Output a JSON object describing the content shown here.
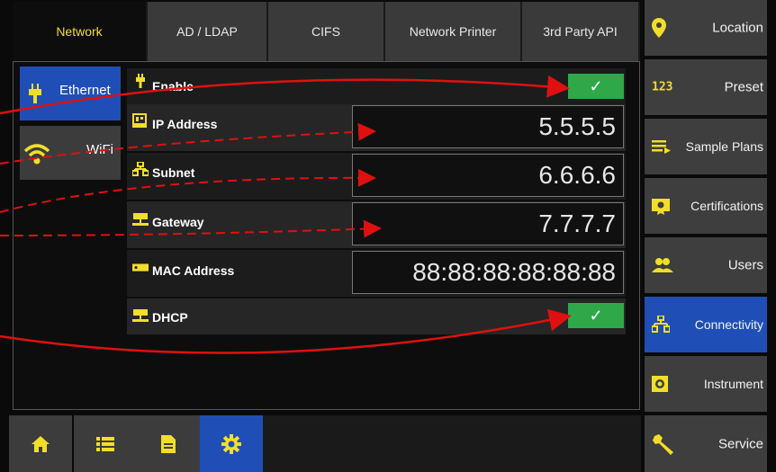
{
  "top_tabs": [
    {
      "label": "Network",
      "active": true
    },
    {
      "label": "AD / LDAP",
      "active": false
    },
    {
      "label": "CIFS",
      "active": false
    },
    {
      "label": "Network Printer",
      "active": false
    },
    {
      "label": "3rd Party API",
      "active": false
    }
  ],
  "left_nav": [
    {
      "label": "Ethernet",
      "icon": "ethernet-plug-icon",
      "active": true
    },
    {
      "label": "WiFi",
      "icon": "wifi-icon",
      "active": false
    }
  ],
  "settings": {
    "enable": {
      "label": "Enable",
      "icon": "plug-icon",
      "checked": true,
      "check_glyph": "✓"
    },
    "ip": {
      "label": "IP Address",
      "icon": "ip-icon",
      "value": "5.5.5.5"
    },
    "subnet": {
      "label": "Subnet",
      "icon": "subnet-icon",
      "value": "6.6.6.6"
    },
    "gateway": {
      "label": "Gateway",
      "icon": "gateway-icon",
      "value": "7.7.7.7"
    },
    "mac": {
      "label": "MAC Address",
      "icon": "mac-icon",
      "value": "88:88:88:88:88:88"
    },
    "dhcp": {
      "label": "DHCP",
      "icon": "dhcp-icon",
      "checked": true,
      "check_glyph": "✓"
    }
  },
  "right_nav": [
    {
      "label": "Location",
      "icon": "location-pin-icon",
      "active": false
    },
    {
      "label": "Preset",
      "icon": "preset-123-icon",
      "icon_text": "123",
      "active": false
    },
    {
      "label": "Sample Plans",
      "icon": "sample-plans-icon",
      "active": false
    },
    {
      "label": "Certifications",
      "icon": "certificate-icon",
      "active": false
    },
    {
      "label": "Users",
      "icon": "users-icon",
      "active": false
    },
    {
      "label": "Connectivity",
      "icon": "network-icon",
      "active": true
    },
    {
      "label": "Instrument",
      "icon": "instrument-gear-icon",
      "active": false
    },
    {
      "label": "Service",
      "icon": "wrench-icon",
      "active": false
    }
  ],
  "bottom_nav": [
    {
      "icon": "home-icon",
      "active": false
    },
    {
      "icon": "list-icon",
      "active": false
    },
    {
      "icon": "document-icon",
      "active": false
    },
    {
      "icon": "settings-gear-icon",
      "active": true
    }
  ],
  "colors": {
    "accent_yellow": "#f2de2a",
    "active_blue": "#1f4fb6",
    "check_green": "#2fa84a",
    "annotation_red": "#e01010"
  }
}
